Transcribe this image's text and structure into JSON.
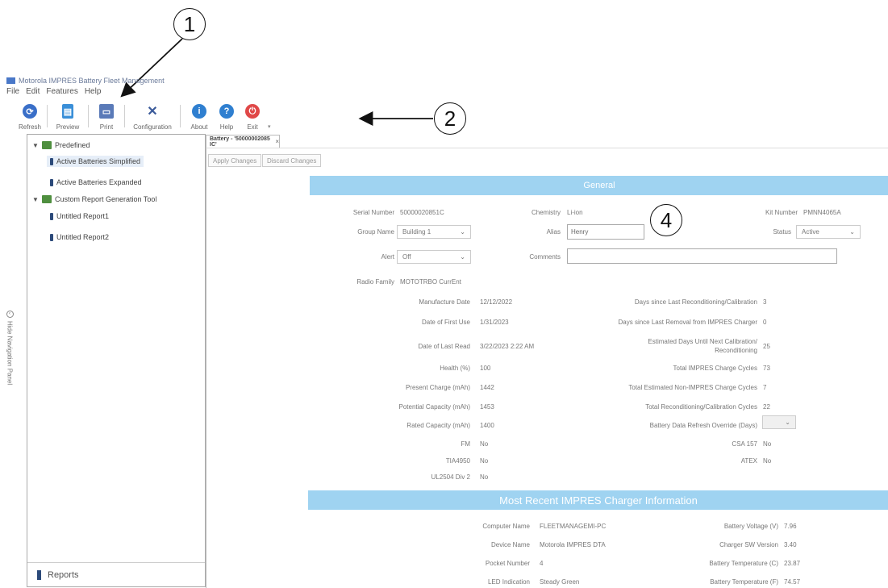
{
  "window": {
    "title": "Motorola IMPRES Battery Fleet Management"
  },
  "menu": [
    "File",
    "Edit",
    "Features",
    "Help"
  ],
  "toolbar": {
    "group1": [
      {
        "label": "Refresh",
        "icon": "refresh-icon",
        "color": "#3a6fc8"
      },
      {
        "label": "Preview",
        "icon": "preview-icon",
        "color": "#3a8fd8"
      },
      {
        "label": "Print",
        "icon": "printer-icon",
        "color": "#5a7ab8"
      },
      {
        "label": "Configuration",
        "icon": "tools-icon",
        "color": "#3a5a9a"
      }
    ],
    "group2": [
      {
        "label": "About",
        "icon": "info-icon",
        "color": "#2f7fd0"
      },
      {
        "label": "Help",
        "icon": "help-icon",
        "color": "#2f7fd0"
      },
      {
        "label": "Exit",
        "icon": "power-icon",
        "color": "#e04848"
      }
    ]
  },
  "callouts": [
    "1",
    "2",
    "3",
    "4"
  ],
  "nav": {
    "predefined": "Predefined",
    "active_simplified": "Active Batteries Simplified",
    "active_expanded": "Active Batteries Expanded",
    "custom_tool": "Custom Report Generation Tool",
    "report1": "Untitled Report1",
    "report2": "Untitled Report2",
    "hide_panel": "Hide Navigation Panel",
    "reports": "Reports"
  },
  "tab": {
    "label": "Battery - '50000002085 IC'",
    "close": "×"
  },
  "actions": {
    "apply": "Apply Changes",
    "discard": "Discard Changes"
  },
  "general": {
    "header": "General",
    "serial_label": "Serial Number",
    "serial": "50000020851C",
    "chemistry_label": "Chemistry",
    "chemistry": "Li-ion",
    "kit_label": "Kit Number",
    "kit": "PMNN4065A",
    "group_label": "Group Name",
    "group": "Building 1",
    "alias_label": "Alias",
    "alias": "Henry",
    "status_label": "Status",
    "status": "Active",
    "alert_label": "Alert",
    "alert": "Off",
    "comments_label": "Comments",
    "comments": "",
    "radio_label": "Radio Family",
    "radio": "MOTOTRBO CurrEnt",
    "mfg_label": "Manufacture Date",
    "mfg": "12/12/2022",
    "first_use_label": "Date of First Use",
    "first_use": "1/31/2023",
    "last_read_label": "Date of Last Read",
    "last_read": "3/22/2023 2:22 AM",
    "health_label": "Health (%)",
    "health": "100",
    "present_label": "Present Charge (mAh)",
    "present": "1442",
    "potential_label": "Potential Capacity (mAh)",
    "potential": "1453",
    "rated_label": "Rated Capacity (mAh)",
    "rated": "1400",
    "fm_label": "FM",
    "fm": "No",
    "tia_label": "TIA4950",
    "tia": "No",
    "ul_label": "UL2504 Div 2",
    "ul": "No",
    "days_recond_label": "Days since Last Reconditioning/Calibration",
    "days_recond": "3",
    "days_removal_label": "Days since Last Removal from IMPRES Charger",
    "days_removal": "0",
    "est_days_label": "Estimated Days Until Next Calibration/ Reconditioning",
    "est_days": "25",
    "total_cycles_label": "Total IMPRES Charge Cycles",
    "total_cycles": "73",
    "non_impres_label": "Total Estimated Non-IMPRES Charge Cycles",
    "non_impres": "7",
    "recond_cycles_label": "Total Reconditioning/Calibration Cycles",
    "recond_cycles": "22",
    "override_label": "Battery Data Refresh Override (Days)",
    "override": "",
    "csa_label": "CSA 157",
    "csa": "No",
    "atex_label": "ATEX",
    "atex": "No"
  },
  "charger": {
    "header": "Most Recent IMPRES Charger Information",
    "computer_label": "Computer Name",
    "computer": "FLEETMANAGEMI-PC",
    "device_label": "Device Name",
    "device": "Motorola IMPRES DTA",
    "pocket_label": "Pocket Number",
    "pocket": "4",
    "led_label": "LED Indication",
    "led": "Steady Green",
    "voltage_label": "Battery Voltage (V)",
    "voltage": "7.96",
    "sw_label": "Charger SW Version",
    "sw": "3.40",
    "temp_c_label": "Battery Temperature (C)",
    "temp_c": "23.87",
    "temp_f_label": "Battery Temperature (F)",
    "temp_f": "74.57"
  }
}
